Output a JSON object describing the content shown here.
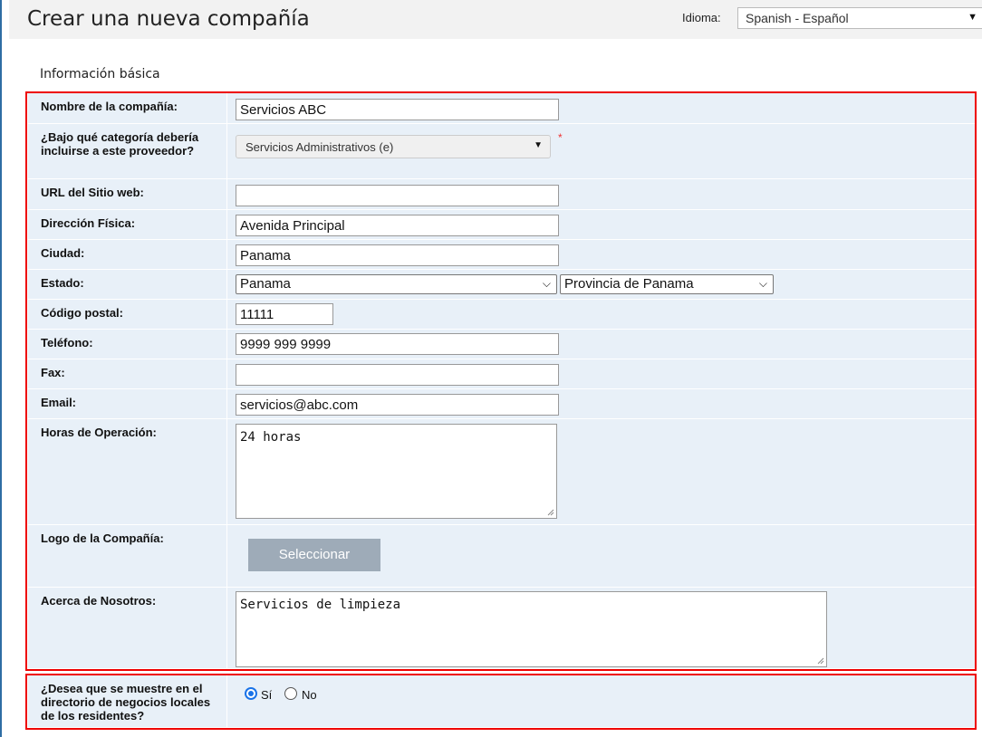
{
  "header": {
    "title": "Crear una nueva compañía",
    "language_label": "Idioma:",
    "language_value": "Spanish - Español"
  },
  "section_title": "Información básica",
  "fields": {
    "company_name": {
      "label": "Nombre de la compañía:",
      "value": "Servicios ABC"
    },
    "category": {
      "label": "¿Bajo qué categoría debería incluirse a este proveedor?",
      "value": "Servicios Administrativos (e)",
      "required_mark": "*"
    },
    "website": {
      "label": "URL del Sitio web:",
      "value": ""
    },
    "address": {
      "label": "Dirección Física:",
      "value": "Avenida Principal"
    },
    "city": {
      "label": "Ciudad:",
      "value": "Panama"
    },
    "state": {
      "label": "Estado:",
      "country_value": "Panama",
      "province_value": "Provincia de Panama"
    },
    "postal_code": {
      "label": "Código postal:",
      "value": "11111"
    },
    "phone": {
      "label": "Teléfono:",
      "value": "9999 999 9999"
    },
    "fax": {
      "label": "Fax:",
      "value": ""
    },
    "email": {
      "label": "Email:",
      "value": "servicios@abc.com"
    },
    "hours": {
      "label": "Horas de Operación:",
      "value": "24 horas"
    },
    "logo": {
      "label": "Logo de la Compañía:",
      "button_label": "Seleccionar"
    },
    "about": {
      "label": "Acerca de Nosotros:",
      "value": "Servicios de limpieza"
    },
    "show_in_directory": {
      "label": "¿Desea que se muestre en el directorio de negocios locales de los residentes?",
      "option_yes": "Sí",
      "option_no": "No",
      "selected": "Sí"
    }
  },
  "colors": {
    "row_bg": "#e8f0f8",
    "highlight_border": "#ee0000",
    "button_bg": "#9eabb8",
    "radio_accent": "#1a73e8"
  }
}
